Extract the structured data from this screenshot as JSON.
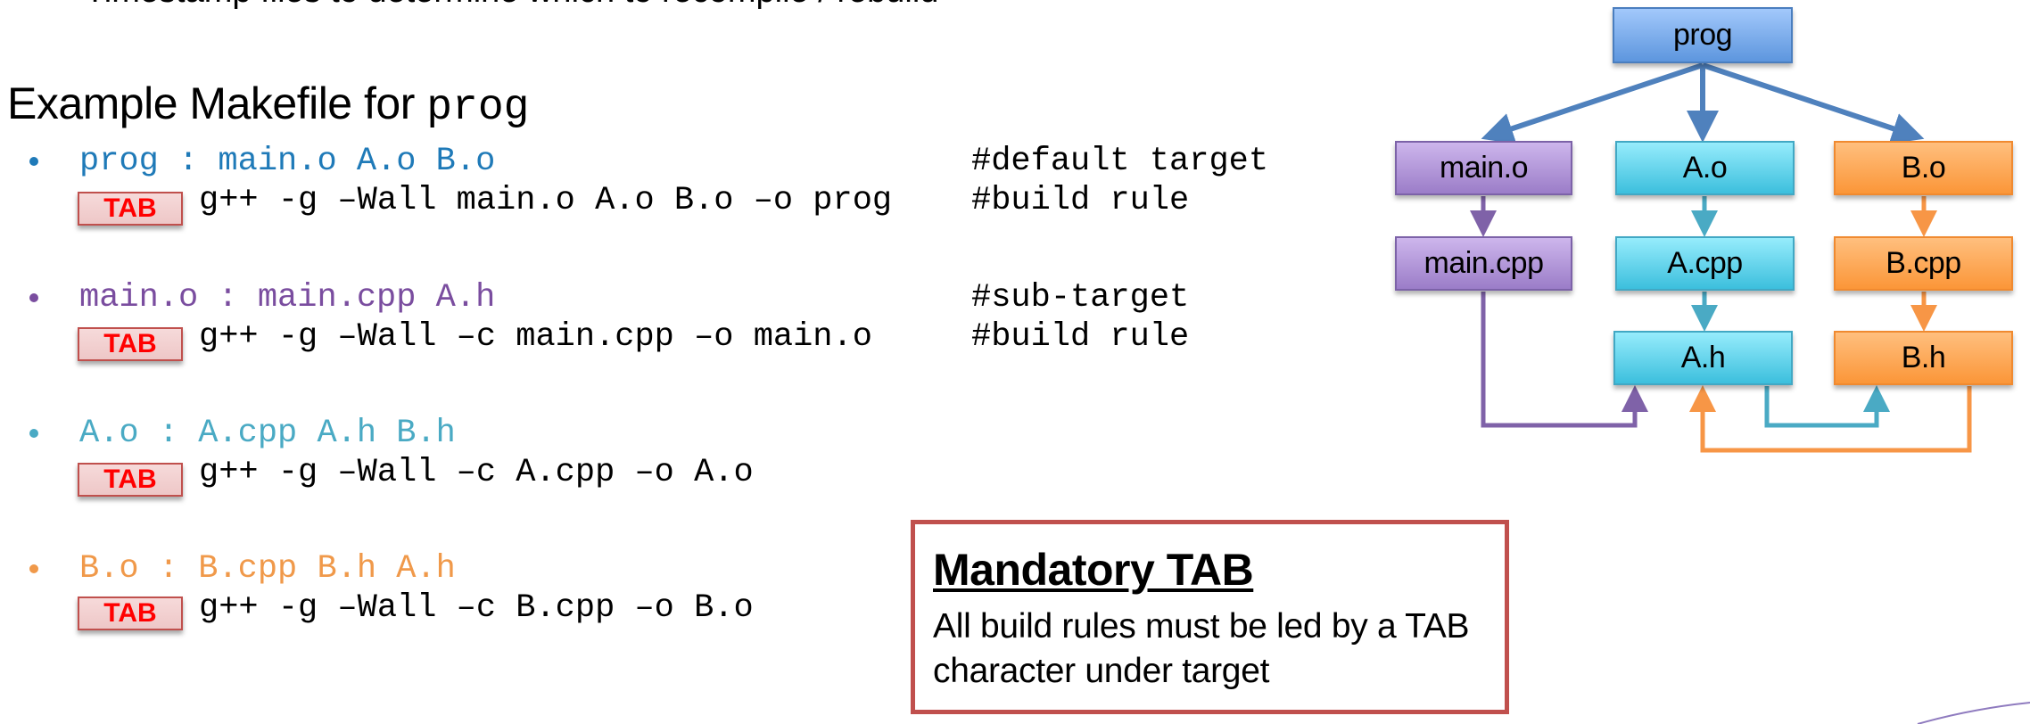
{
  "slide": {
    "cut_off_line": "Timestamp files to determine which to recompile / rebuild",
    "heading": {
      "text": "Example Makefile for ",
      "code": "prog"
    }
  },
  "makefile": {
    "tab_label": "TAB",
    "rules": [
      {
        "target_line": "prog : main.o A.o B.o",
        "target_comment": "#default target",
        "build_line": "g++ -g –Wall main.o A.o B.o –o prog",
        "build_comment": "#build rule",
        "color": "#1f7ab8"
      },
      {
        "target_line": "main.o : main.cpp A.h",
        "target_comment": "#sub-target",
        "build_line": "g++ -g –Wall –c main.cpp –o main.o",
        "build_comment": "#build rule",
        "color": "#7a4d9f"
      },
      {
        "target_line": "A.o : A.cpp A.h B.h",
        "target_comment": "",
        "build_line": "g++ -g –Wall –c A.cpp –o A.o",
        "build_comment": "",
        "color": "#4aaac4"
      },
      {
        "target_line": "B.o : B.cpp B.h A.h",
        "target_comment": "",
        "build_line": "g++ -g –Wall –c B.cpp –o B.o",
        "build_comment": "",
        "color": "#f0994a"
      }
    ]
  },
  "note": {
    "title": "Mandatory TAB",
    "body": "All build rules must be led by a TAB character under target",
    "border_color": "#c0504d"
  },
  "diagram": {
    "nodes": [
      {
        "id": "prog",
        "label": "prog",
        "group": "blue"
      },
      {
        "id": "main_o",
        "label": "main.o",
        "group": "purple"
      },
      {
        "id": "a_o",
        "label": "A.o",
        "group": "teal"
      },
      {
        "id": "b_o",
        "label": "B.o",
        "group": "orange"
      },
      {
        "id": "main_cpp",
        "label": "main.cpp",
        "group": "purple"
      },
      {
        "id": "a_cpp",
        "label": "A.cpp",
        "group": "teal"
      },
      {
        "id": "b_cpp",
        "label": "B.cpp",
        "group": "orange"
      },
      {
        "id": "a_h",
        "label": "A.h",
        "group": "teal"
      },
      {
        "id": "b_h",
        "label": "B.h",
        "group": "orange"
      }
    ],
    "edges": [
      {
        "from": "prog",
        "to": "main_o",
        "color": "#4f81bd"
      },
      {
        "from": "prog",
        "to": "a_o",
        "color": "#4f81bd"
      },
      {
        "from": "prog",
        "to": "b_o",
        "color": "#4f81bd"
      },
      {
        "from": "main_o",
        "to": "main_cpp",
        "color": "#7f62a8"
      },
      {
        "from": "a_o",
        "to": "a_cpp",
        "color": "#4aaac4"
      },
      {
        "from": "b_o",
        "to": "b_cpp",
        "color": "#f79646"
      },
      {
        "from": "a_cpp",
        "to": "a_h",
        "color": "#4aaac4"
      },
      {
        "from": "b_cpp",
        "to": "b_h",
        "color": "#f79646"
      },
      {
        "from": "main_cpp",
        "to": "a_h",
        "color": "#7f62a8"
      },
      {
        "from": "a_h",
        "to": "b_h",
        "color": "#4aaac4"
      },
      {
        "from": "b_h",
        "to": "a_h",
        "color": "#f79646"
      }
    ]
  }
}
